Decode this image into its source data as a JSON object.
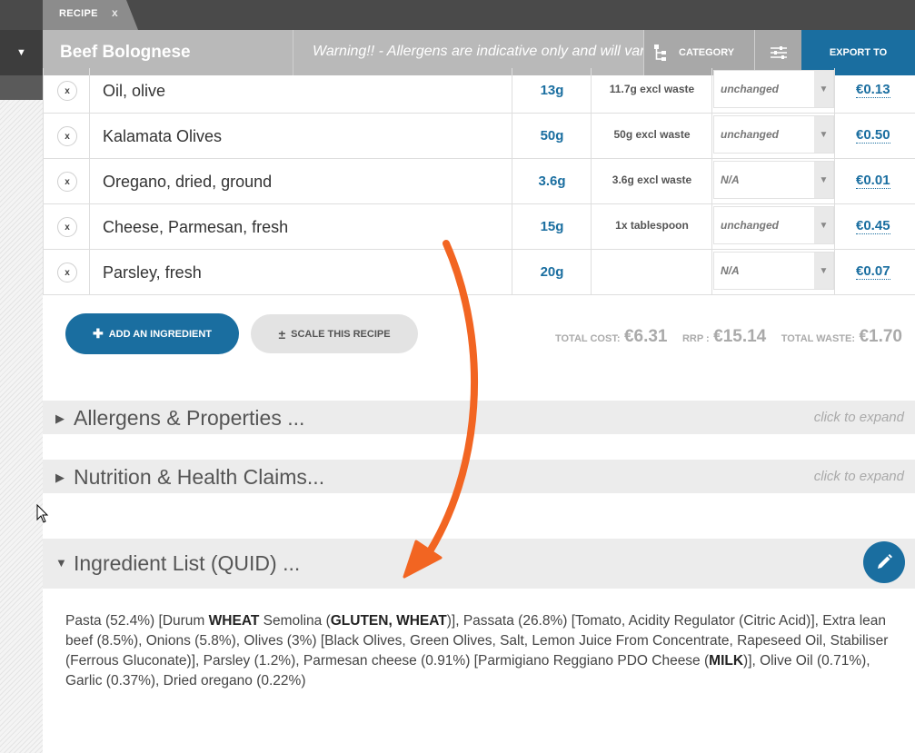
{
  "tab": {
    "label": "RECIPE",
    "close": "x"
  },
  "header": {
    "title": "Beef Bolognese",
    "warning": "Warning!! - Allergens are indicative only and will vary",
    "category_label": "CATEGORY",
    "export_label": "EXPORT TO",
    "menu_toggle": "▼"
  },
  "ingredients": [
    {
      "remove": "x",
      "name": "Oil, olive",
      "qty": "13g",
      "waste": "11.7g excl waste",
      "state": "unchanged",
      "cost": "€0.13"
    },
    {
      "remove": "x",
      "name": "Kalamata Olives",
      "qty": "50g",
      "waste": "50g excl waste",
      "state": "unchanged",
      "cost": "€0.50"
    },
    {
      "remove": "x",
      "name": "Oregano, dried, ground",
      "qty": "3.6g",
      "waste": "3.6g excl waste",
      "state": "N/A",
      "cost": "€0.01"
    },
    {
      "remove": "x",
      "name": "Cheese, Parmesan, fresh",
      "qty": "15g",
      "waste": "1x tablespoon",
      "state": "unchanged",
      "cost": "€0.45"
    },
    {
      "remove": "x",
      "name": "Parsley, fresh",
      "qty": "20g",
      "waste": "",
      "state": "N/A",
      "cost": "€0.07"
    }
  ],
  "actions": {
    "add_label": "ADD AN INGREDIENT",
    "add_icon": "✚",
    "scale_label": "SCALE THIS RECIPE",
    "scale_icon": "±"
  },
  "totals": {
    "total_cost_label": "TOTAL COST:",
    "total_cost": "€6.31",
    "rrp_label": "RRP :",
    "rrp": "€15.14",
    "total_waste_label": "TOTAL WASTE:",
    "total_waste": "€1.70"
  },
  "sections": {
    "allergens": {
      "arrow": "▶",
      "title": "Allergens & Properties ...",
      "hint": "click to expand"
    },
    "nutrition": {
      "arrow": "▶",
      "title": "Nutrition & Health Claims...",
      "hint": "click to expand"
    },
    "quid": {
      "arrow": "▼",
      "title": "Ingredient List (QUID) ..."
    }
  },
  "quid_text": [
    {
      "t": "Pasta (52.4%) [Durum "
    },
    {
      "t": "WHEAT",
      "b": true
    },
    {
      "t": " Semolina ("
    },
    {
      "t": "GLUTEN, WHEAT",
      "b": true
    },
    {
      "t": ")], Passata (26.8%) [Tomato, Acidity Regulator (Citric Acid)], Extra lean beef (8.5%), Onions (5.8%), Olives (3%) [Black Olives, Green Olives, Salt, Lemon Juice From Concentrate, Rapeseed Oil, Stabiliser (Ferrous Gluconate)], Parsley (1.2%), Parmesan cheese (0.91%) [Parmigiano Reggiano PDO Cheese ("
    },
    {
      "t": "MILK",
      "b": true
    },
    {
      "t": ")], Olive Oil (0.71%), Garlic (0.37%), Dried oregano (0.22%)"
    }
  ],
  "icons": {
    "category": "hierarchy-icon",
    "filter": "sliders-icon",
    "edit": "pencil-icon",
    "select_arrow": "▼"
  },
  "colors": {
    "accent": "#1a6ea0",
    "annotation_arrow": "#f26522"
  }
}
